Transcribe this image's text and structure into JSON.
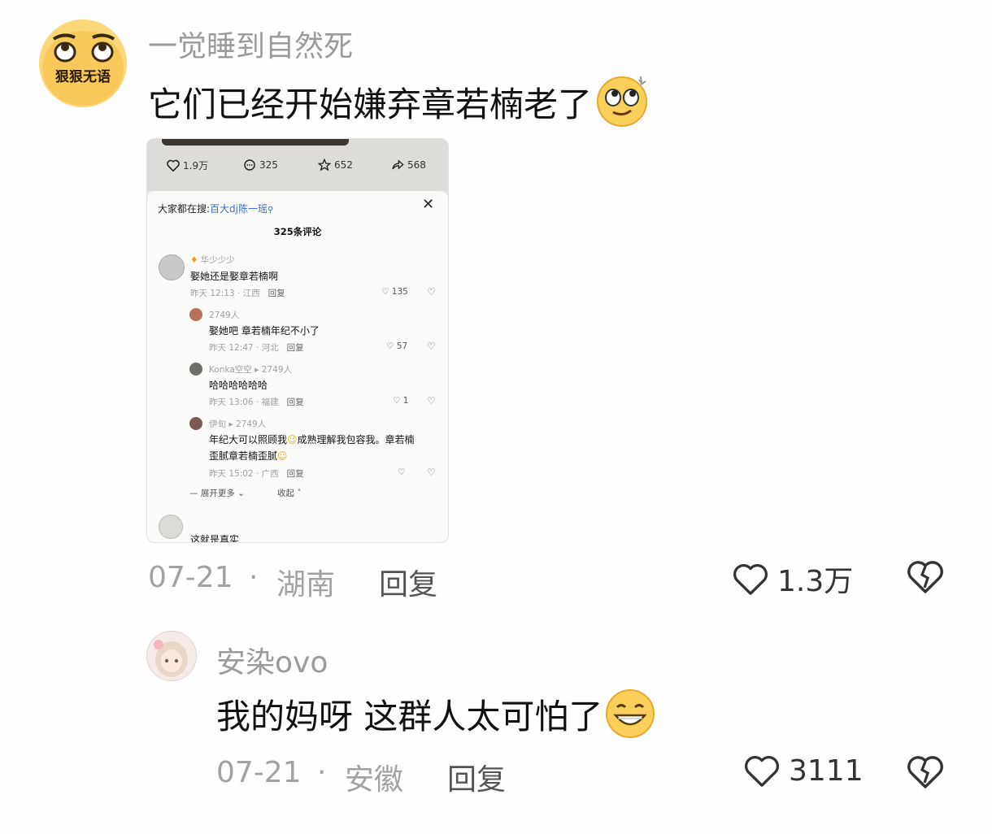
{
  "comments": [
    {
      "username": "一觉睡到自然死",
      "avatar_text": "狠狠无语",
      "text": "它们已经开始嫌弃章若楠老了",
      "emoji": "eye-roll-emoji",
      "date": "07-21",
      "location": "湖南",
      "reply_label": "回复",
      "likes": "1.3万"
    },
    {
      "username": "安染ovo",
      "text": "我的妈呀 这群人太可怕了",
      "emoji": "grin-sweat-emoji",
      "date": "07-21",
      "location": "安徽",
      "reply_label": "回复",
      "likes": "3111"
    }
  ],
  "separator": "·",
  "embedded_screenshot": {
    "stats": {
      "likes": "1.9万",
      "comments": "325",
      "favorites": "652",
      "shares": "568"
    },
    "search_prefix": "大家都在搜:",
    "search_term": "百大dj陈一瑶",
    "comment_count_title": "325条评论",
    "comments": [
      {
        "user": "华少少少",
        "text": "娶她还是娶章若楠啊",
        "meta": "昨天 12:13 · 江西",
        "reply": "回复",
        "likes": "135"
      },
      {
        "user": "2749人",
        "text": "娶她吧 章若楠年纪不小了",
        "meta": "昨天 12:47 · 河北",
        "reply": "回复",
        "likes": "57"
      },
      {
        "user": "Konka空空",
        "to": "2749人",
        "text": "哈哈哈哈哈哈",
        "meta": "昨天 13:06 · 福建",
        "reply": "回复",
        "likes": "1"
      },
      {
        "user": "伊旬",
        "to": "2749人",
        "text_line1": "年纪大可以照顾我",
        "text_line1b": "成熟理解我包容我。章若楠",
        "text_line2": "歪腻章若楠歪腻",
        "meta": "昨天 15:02 · 广西",
        "reply": "回复",
        "likes": ""
      }
    ],
    "expand_more": "展开更多",
    "collapse": "收起",
    "last_comment_text": "这就是真实"
  },
  "colors": {
    "meta_gray": "#a2a2a2",
    "link_blue": "#3b6fb6",
    "username_gray": "#9b9b9b"
  }
}
